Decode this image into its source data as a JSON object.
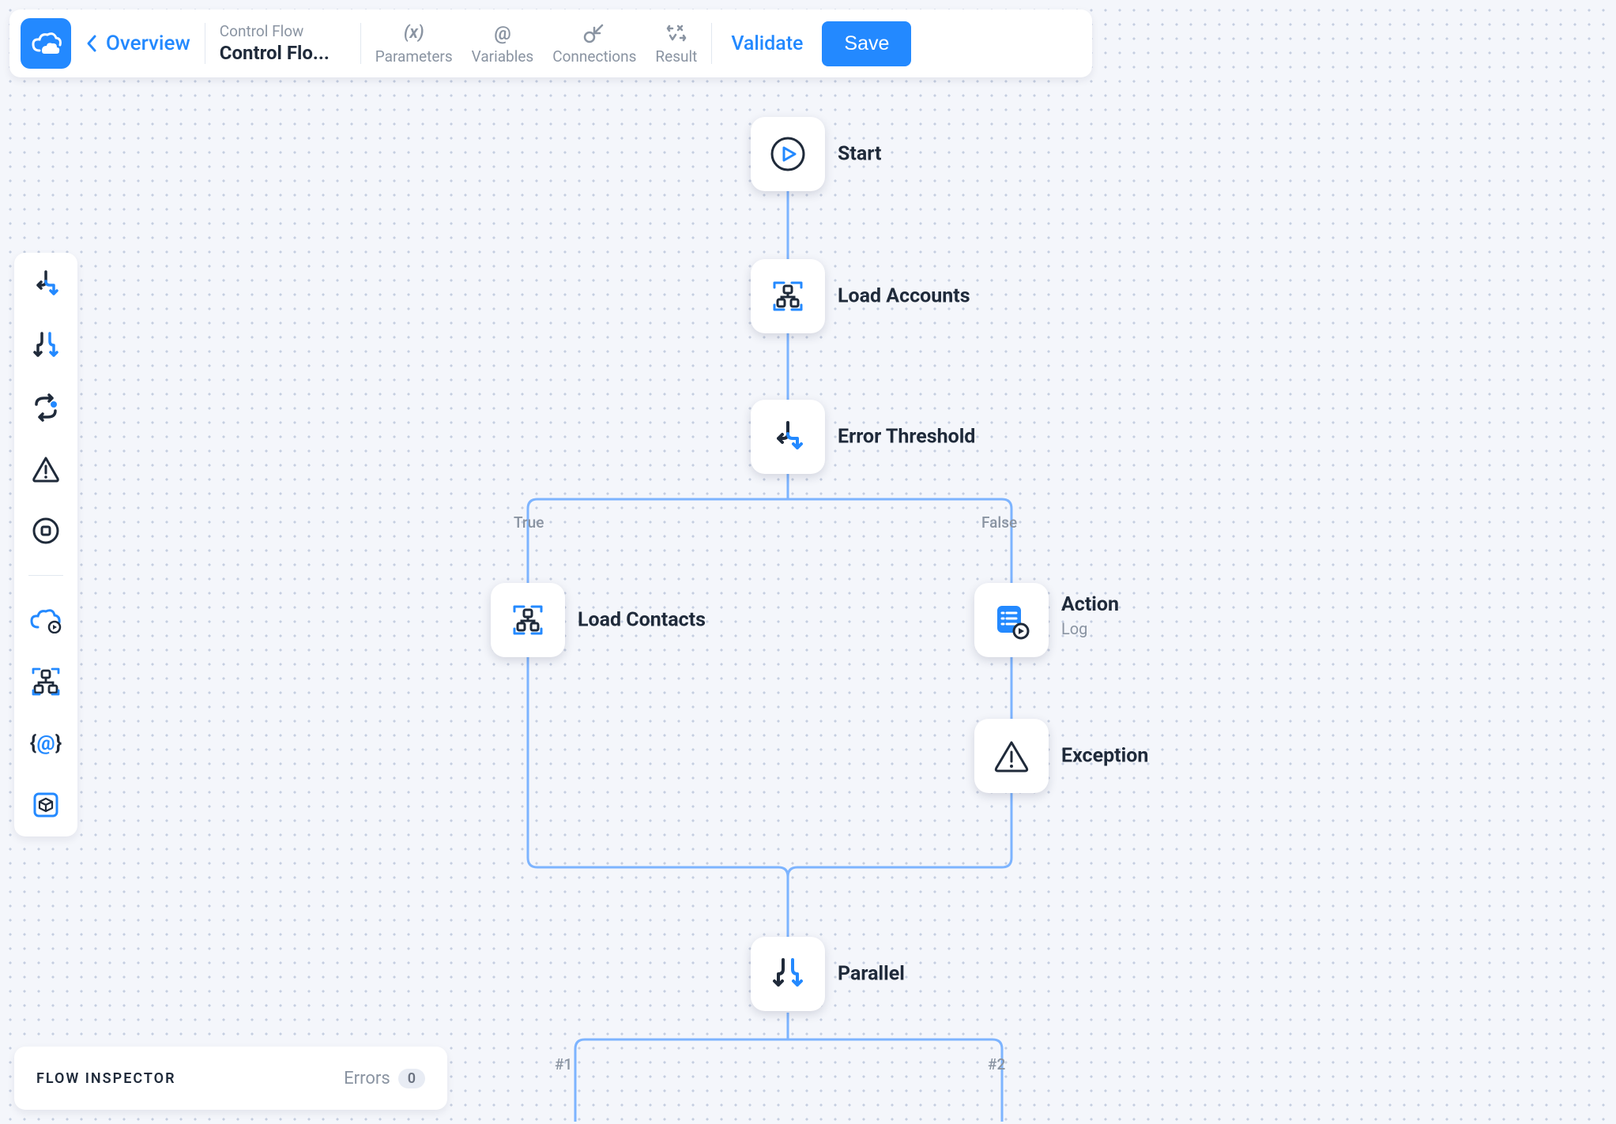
{
  "header": {
    "overview_label": "Overview",
    "breadcrumb_category": "Control Flow",
    "breadcrumb_title": "Control Flo...",
    "actions": {
      "parameters": "Parameters",
      "variables": "Variables",
      "connections": "Connections",
      "result": "Result"
    },
    "validate_label": "Validate",
    "save_label": "Save"
  },
  "palette": {
    "items": [
      {
        "name": "conditional-icon"
      },
      {
        "name": "parallel-icon"
      },
      {
        "name": "loop-icon"
      },
      {
        "name": "warning-icon"
      },
      {
        "name": "stop-icon"
      },
      {
        "name": "cloud-run-icon"
      },
      {
        "name": "tenant-icon"
      },
      {
        "name": "variable-icon"
      },
      {
        "name": "package-icon"
      }
    ]
  },
  "flow": {
    "nodes": {
      "start": {
        "label": "Start"
      },
      "load_accounts": {
        "label": "Load Accounts"
      },
      "error_threshold": {
        "label": "Error Threshold"
      },
      "load_contacts": {
        "label": "Load Contacts"
      },
      "action": {
        "label": "Action",
        "sub": "Log"
      },
      "exception": {
        "label": "Exception"
      },
      "parallel": {
        "label": "Parallel"
      }
    },
    "branches": {
      "true_label": "True",
      "false_label": "False",
      "lane1": "#1",
      "lane2": "#2"
    }
  },
  "inspector": {
    "title": "FLOW INSPECTOR",
    "errors_label": "Errors",
    "errors_count": "0"
  }
}
